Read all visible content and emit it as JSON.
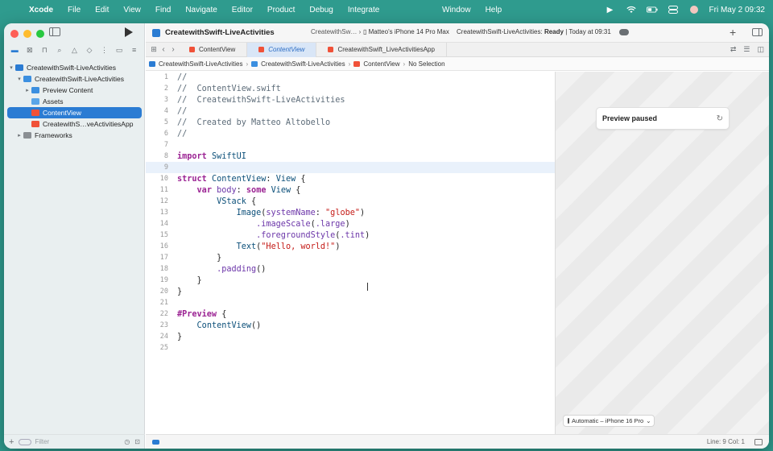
{
  "menubar": {
    "app_name": "Xcode",
    "menus": [
      "File",
      "Edit",
      "View",
      "Find",
      "Navigate",
      "Editor",
      "Product",
      "Debug",
      "Integrate"
    ],
    "menus_right": [
      "Window",
      "Help"
    ],
    "clock": "Fri May 2  09:32"
  },
  "toolbar": {
    "project_title": "CreatewithSwift-LiveActivities",
    "scheme": "CreatewithSw…",
    "device": "Matteo's iPhone 14 Pro Max",
    "status_project": "CreatewithSwift-LiveActivities:",
    "status_state": "Ready",
    "status_time": "| Today at 09:31"
  },
  "navigator": {
    "items": [
      {
        "label": "CreatewithSwift-LiveActivities",
        "icon": "project-icon"
      },
      {
        "label": "CreatewithSwift-LiveActivities",
        "icon": "folder-icon"
      },
      {
        "label": "Preview Content",
        "icon": "folder-icon"
      },
      {
        "label": "Assets",
        "icon": "assets-icon"
      },
      {
        "label": "ContentView",
        "icon": "swift-file-icon"
      },
      {
        "label": "CreatewithS…veActivitiesApp",
        "icon": "swift-file-icon"
      },
      {
        "label": "Frameworks",
        "icon": "folder-icon"
      }
    ],
    "filter_placeholder": "Filter"
  },
  "tabs": [
    {
      "label": "ContentView"
    },
    {
      "label": "ContentView"
    },
    {
      "label": "CreatewithSwift_LiveActivitiesApp"
    }
  ],
  "jumpbar": {
    "project": "CreatewithSwift-LiveActivities",
    "group": "CreatewithSwift-LiveActivities",
    "file": "ContentView",
    "selection": "No Selection"
  },
  "code_lines": [
    "//",
    "//  ContentView.swift",
    "//  CreatewithSwift-LiveActivities",
    "//",
    "//  Created by Matteo Altobello",
    "//",
    "",
    "import SwiftUI",
    "",
    "struct ContentView: View {",
    "    var body: some View {",
    "        VStack {",
    "            Image(systemName: \"globe\")",
    "                .imageScale(.large)",
    "                .foregroundStyle(.tint)",
    "            Text(\"Hello, world!\")",
    "        }",
    "        .padding()",
    "    }",
    "}",
    "",
    "#Preview {",
    "    ContentView()",
    "}",
    ""
  ],
  "line_numbers": [
    "1",
    "2",
    "3",
    "4",
    "5",
    "6",
    "7",
    "8",
    "9",
    "10",
    "11",
    "12",
    "13",
    "14",
    "15",
    "16",
    "17",
    "18",
    "19",
    "20",
    "21",
    "22",
    "23",
    "24",
    "25"
  ],
  "preview": {
    "status": "Preview paused",
    "device_picker": "Automatic – iPhone 16 Pro"
  },
  "statusbar": {
    "position": "Line: 9  Col: 1"
  },
  "colors": {
    "desktop": "#2f9b8e",
    "accent": "#2b7cd3",
    "swift": "#f05138"
  }
}
